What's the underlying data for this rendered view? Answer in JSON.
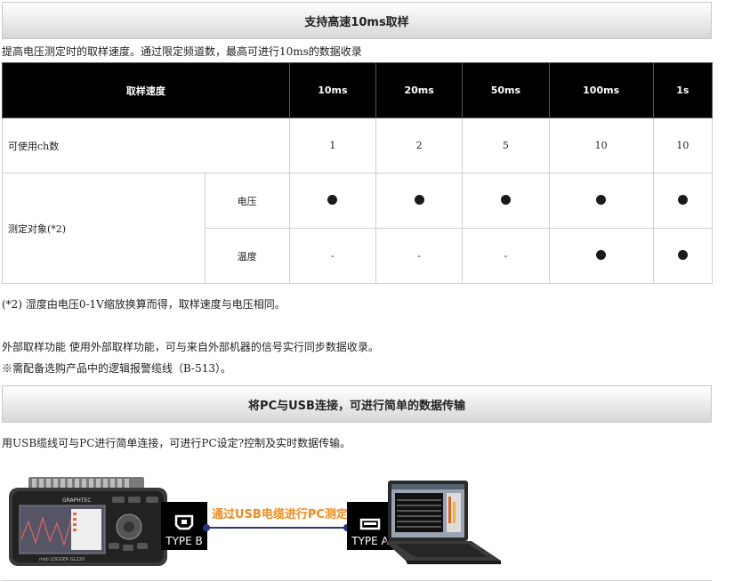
{
  "section1": {
    "title": "支持高速10ms取样",
    "intro": "提高电压测定时的取样速度。通过限定频道数，最高可进行10ms的数据收录"
  },
  "spec_table": {
    "header_label": "取样速度",
    "speeds": [
      "10ms",
      "20ms",
      "50ms",
      "100ms",
      "1s"
    ],
    "channels_label": "可使用ch数",
    "channels": [
      "1",
      "2",
      "5",
      "10",
      "10"
    ],
    "target_label": "测定对象(*2)",
    "voltage_label": "电压",
    "voltage": [
      "●",
      "●",
      "●",
      "●",
      "●"
    ],
    "temperature_label": "温度",
    "temperature": [
      "-",
      "-",
      "-",
      "●",
      "●"
    ]
  },
  "notes": {
    "note2": "(*2) 湿度由电压0-1V缩放换算而得，取样速度与电压相同。",
    "external": "外部取样功能 使用外部取样功能，可与来自外部机器的信号实行同步数据收录。",
    "cable": "※需配备选购产品中的逻辑报警缆线（B-513）。"
  },
  "section2": {
    "title": "将PC与USB连接，可进行简单的数据传输",
    "intro": "用USB缆线可与PC进行简单连接，可进行PC设定?控制及实时数据传输。"
  },
  "diagram": {
    "device_brand": "GRAPHTEC",
    "device_model": "midi LOGGER GL220",
    "type_b": "TYPE B",
    "type_a": "TYPE A",
    "cable_label": "通过USB电缆进行PC测定"
  }
}
